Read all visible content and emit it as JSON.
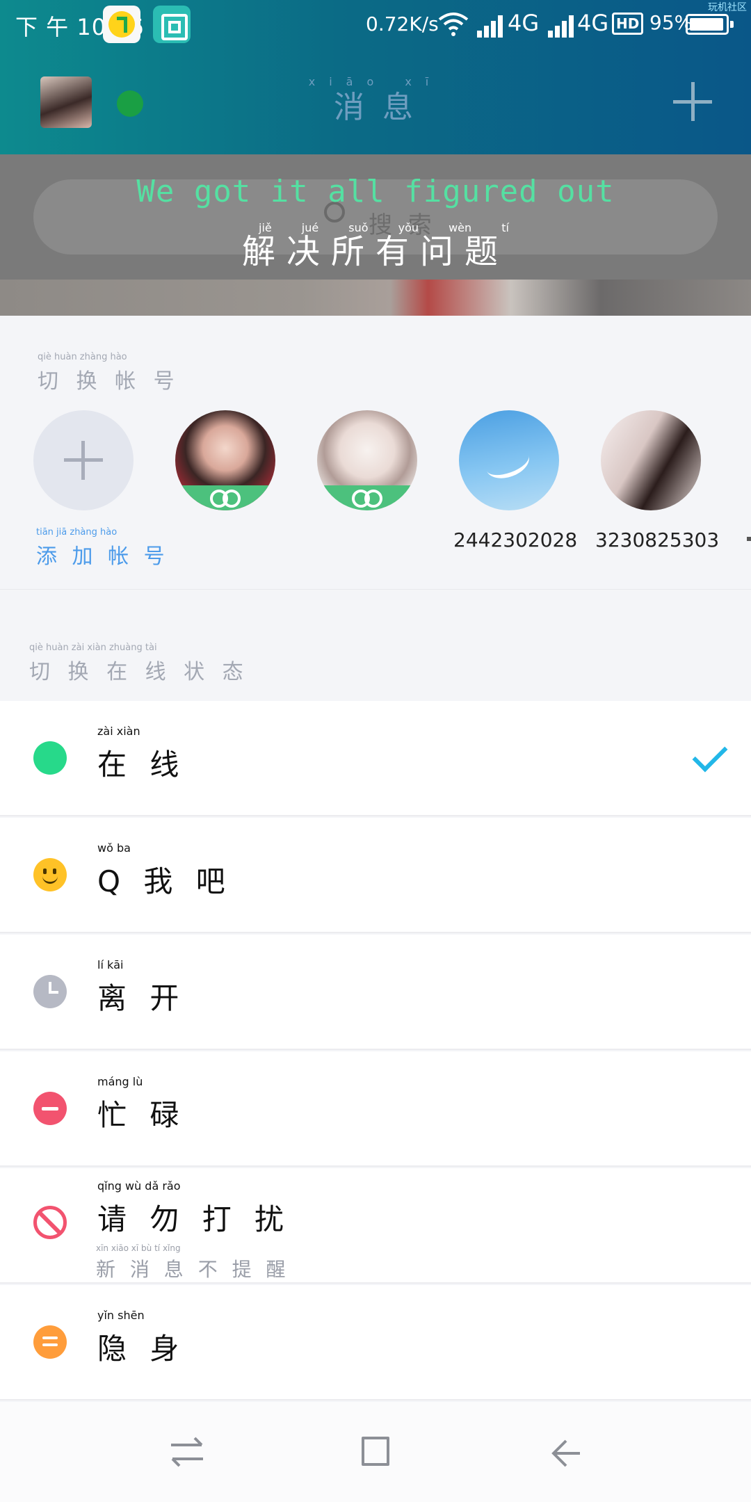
{
  "status_bar": {
    "time": "下 午 10:06",
    "speed": "0.72K/s",
    "net1": "4G",
    "net2": "4G",
    "hd": "HD",
    "battery": "95%",
    "corner_text": "玩机社区"
  },
  "header": {
    "title": "消 息",
    "title_pinyin": "xiāo xī"
  },
  "search": {
    "placeholder": "搜 索"
  },
  "lyrics": {
    "english": "We got it all figured out",
    "chinese": "解决所有问题",
    "pinyin": [
      "jiě",
      "jué",
      "suǒ",
      "yǒu",
      "wèn",
      "tí"
    ]
  },
  "switch_account": {
    "title": "切 换 帐 号",
    "title_pinyin": "qiè huàn zhàng hào",
    "add_label": "添 加 帐 号",
    "add_pinyin": "tiān jiā zhàng hào",
    "accounts": [
      {
        "label": ""
      },
      {
        "label": ""
      },
      {
        "label": "2442302028"
      },
      {
        "label": "3230825303"
      }
    ]
  },
  "switch_status": {
    "title": "切 换 在 线 状 态",
    "title_pinyin": "qiè huàn zài xiàn zhuàng tài"
  },
  "statuses": [
    {
      "label": "在 线",
      "pinyin": "zài xiàn",
      "icon": "online-dot-icon",
      "color": "#27d98a",
      "selected": true
    },
    {
      "label": "Q 我 吧",
      "pinyin": "   wǒ   ba",
      "icon": "smile-icon",
      "color": "#ffc227"
    },
    {
      "label": "离 开",
      "pinyin": "lí   kāi",
      "icon": "clock-icon",
      "color": "#b6b9c4"
    },
    {
      "label": "忙 碌",
      "pinyin": "máng lù",
      "icon": "minus-icon",
      "color": "#f2536f"
    },
    {
      "label": "请 勿 打 扰",
      "pinyin": "qǐng wù dǎ rǎo",
      "sub": "新 消 息 不 提 醒",
      "sub_pinyin": "xīn xiāo xī bù tí xǐng",
      "icon": "forbidden-icon",
      "color": "#f2536f"
    },
    {
      "label": "隐 身",
      "pinyin": "yǐn shēn",
      "icon": "equal-icon",
      "color": "#ff9d3b"
    }
  ]
}
